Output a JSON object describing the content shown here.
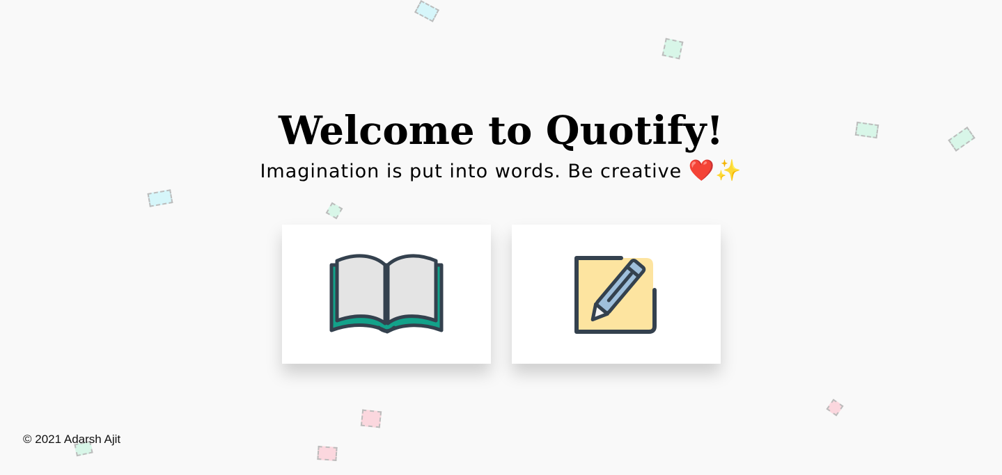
{
  "header": {
    "title": "Welcome to Quotify!",
    "subtitle": "Imagination is put into words. Be creative",
    "heart_glyph": "❤️",
    "sparkle_glyph": "✨"
  },
  "cards": [
    {
      "name": "read-quotes-card",
      "icon": "open-book-icon"
    },
    {
      "name": "write-quote-card",
      "icon": "note-pencil-icon"
    }
  ],
  "footer": {
    "copyright": "© 2021 Adarsh Ajit"
  },
  "colors": {
    "background": "#f9f9f9",
    "card": "#ffffff",
    "icon_stroke": "#34414e",
    "book_pages": "#e4e4e4",
    "book_cover": "#13a28a",
    "note_paper": "#fde4a0",
    "pencil_body": "#9fbfdb",
    "confetti_blue": "#d3f6fb",
    "confetti_green": "#d5f6e7",
    "confetti_pink": "#fcd4dc"
  }
}
